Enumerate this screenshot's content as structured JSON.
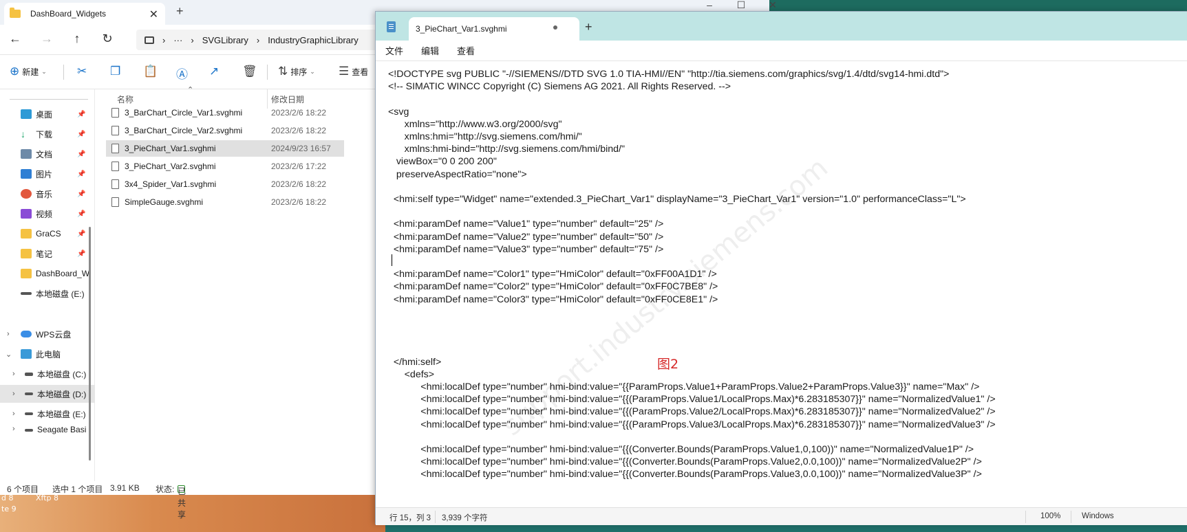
{
  "explorer": {
    "tab_title": "DashBoard_Widgets",
    "breadcrumb": [
      "SVGLibrary",
      "IndustryGraphicLibrary"
    ],
    "breadcrumb_more": "···",
    "toolbar": {
      "new_label": "新建",
      "sort_label": "排序",
      "view_label": "查看"
    },
    "nav": {
      "quick": [
        {
          "label": "桌面",
          "icon": "desktop-icon"
        },
        {
          "label": "下载",
          "icon": "download-icon"
        },
        {
          "label": "文档",
          "icon": "documents-icon"
        },
        {
          "label": "图片",
          "icon": "pictures-icon"
        },
        {
          "label": "音乐",
          "icon": "music-icon"
        },
        {
          "label": "视频",
          "icon": "video-icon"
        },
        {
          "label": "GraCS",
          "icon": "folder-icon"
        },
        {
          "label": "笔记",
          "icon": "folder-icon"
        },
        {
          "label": "DashBoard_Wi",
          "icon": "folder-icon"
        },
        {
          "label": "本地磁盘 (E:)",
          "icon": "drive-icon"
        }
      ],
      "wps_cloud": "WPS云盘",
      "this_pc": "此电脑",
      "drives": [
        "本地磁盘 (C:)",
        "本地磁盘 (D:)",
        "本地磁盘 (E:)",
        "Seagate Basi"
      ]
    },
    "columns": {
      "name": "名称",
      "modified": "修改日期"
    },
    "files": [
      {
        "name": "3_BarChart_Circle_Var1.svghmi",
        "date": "2023/2/6 18:22"
      },
      {
        "name": "3_BarChart_Circle_Var2.svghmi",
        "date": "2023/2/6 18:22"
      },
      {
        "name": "3_PieChart_Var1.svghmi",
        "date": "2024/9/23 16:57",
        "selected": true
      },
      {
        "name": "3_PieChart_Var2.svghmi",
        "date": "2023/2/6 17:22"
      },
      {
        "name": "3x4_Spider_Var1.svghmi",
        "date": "2023/2/6 18:22"
      },
      {
        "name": "SimpleGauge.svghmi",
        "date": "2023/2/6 18:22"
      }
    ],
    "status": {
      "item_count": "6 个项目",
      "selection": "选中 1 个项目",
      "size": "3.91 KB",
      "state_label": "状态:",
      "state_value": "已共享"
    }
  },
  "desktop_text": [
    "d 8",
    "Xftp 8",
    "te 9"
  ],
  "notepad": {
    "tab_title": "3_PieChart_Var1.svghmi",
    "menu": [
      "文件",
      "编辑",
      "查看"
    ],
    "lines": [
      "<!DOCTYPE svg PUBLIC \"-//SIEMENS//DTD SVG 1.0 TIA-HMI//EN\" \"http://tia.siemens.com/graphics/svg/1.4/dtd/svg14-hmi.dtd\">",
      "<!-- SIMATIC WINCC Copyright (C) Siemens AG 2021. All Rights Reserved. -->",
      "",
      "<svg",
      "      xmlns=\"http://www.w3.org/2000/svg\"",
      "      xmlns:hmi=\"http://svg.siemens.com/hmi/\"",
      "      xmlns:hmi-bind=\"http://svg.siemens.com/hmi/bind/\"",
      "   viewBox=\"0 0 200 200\"",
      "   preserveAspectRatio=\"none\">",
      "",
      "  <hmi:self type=\"Widget\" name=\"extended.3_PieChart_Var1\" displayName=\"3_PieChart_Var1\" version=\"1.0\" performanceClass=\"L\">",
      "",
      "  <hmi:paramDef name=\"Value1\" type=\"number\" default=\"25\" />",
      "  <hmi:paramDef name=\"Value2\" type=\"number\" default=\"50\" />",
      "  <hmi:paramDef name=\"Value3\" type=\"number\" default=\"75\" />",
      "",
      "  <hmi:paramDef name=\"Color1\" type=\"HmiColor\" default=\"0xFF00A1D1\" />",
      "  <hmi:paramDef name=\"Color2\" type=\"HmiColor\" default=\"0xFF0C7BE8\" />",
      "  <hmi:paramDef name=\"Color3\" type=\"HmiColor\" default=\"0xFF0CE8E1\" />",
      "",
      "",
      "",
      "",
      "  </hmi:self>",
      "      <defs>",
      "            <hmi:localDef type=\"number\" hmi-bind:value=\"{{ParamProps.Value1+ParamProps.Value2+ParamProps.Value3}}\" name=\"Max\" />",
      "            <hmi:localDef type=\"number\" hmi-bind:value=\"{{(ParamProps.Value1/LocalProps.Max)*6.283185307}}\" name=\"NormalizedValue1\" />",
      "            <hmi:localDef type=\"number\" hmi-bind:value=\"{{(ParamProps.Value2/LocalProps.Max)*6.283185307}}\" name=\"NormalizedValue2\" />",
      "            <hmi:localDef type=\"number\" hmi-bind:value=\"{{(ParamProps.Value3/LocalProps.Max)*6.283185307}}\" name=\"NormalizedValue3\" />",
      "",
      "            <hmi:localDef type=\"number\" hmi-bind:value=\"{{(Converter.Bounds(ParamProps.Value1,0,100))\" name=\"NormalizedValue1P\" />",
      "            <hmi:localDef type=\"number\" hmi-bind:value=\"{{(Converter.Bounds(ParamProps.Value2,0.0,100))\" name=\"NormalizedValue2P\" />",
      "            <hmi:localDef type=\"number\" hmi-bind:value=\"{{(Converter.Bounds(ParamProps.Value3,0.0,100))\" name=\"NormalizedValue3P\" />"
    ],
    "figure_label": "图2",
    "status": {
      "cursor": "行 15，列 3",
      "chars": "3,939 个字符",
      "zoom": "100%",
      "line_ending": "Windows"
    }
  }
}
